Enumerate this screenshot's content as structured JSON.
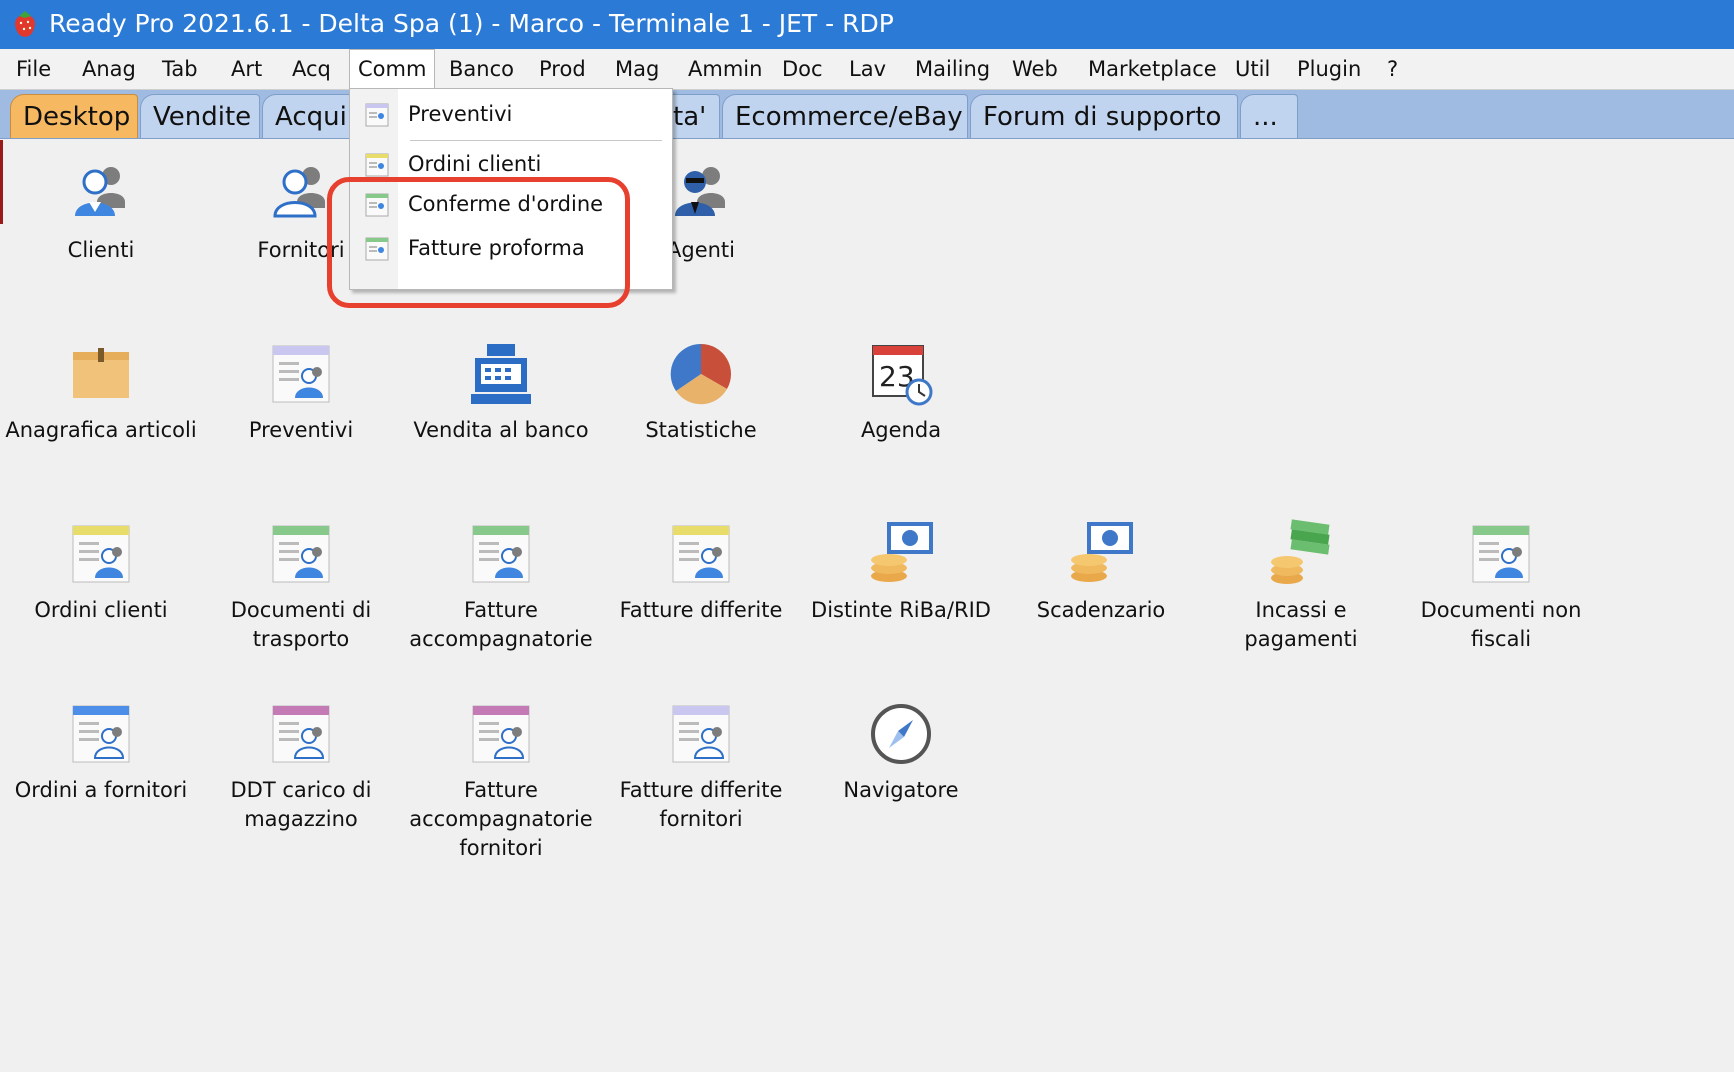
{
  "window": {
    "title": "Ready Pro 2021.6.1 - Delta Spa (1) - Marco - Terminale 1 - JET - RDP",
    "icon": "strawberry-icon"
  },
  "menubar": {
    "items": [
      "File",
      "Anag",
      "Tab",
      "Art",
      "Acq",
      "Comm",
      "Banco",
      "Prod",
      "Mag",
      "Ammin",
      "Doc",
      "Lav",
      "Mailing",
      "Web",
      "Marketplace",
      "Util",
      "Plugin",
      "?"
    ],
    "active": "Comm"
  },
  "tabs": {
    "items": [
      "Desktop",
      "Vendite",
      "Acqui",
      "ta'",
      "Ecommerce/eBay",
      "Forum di supporto",
      "..."
    ],
    "active": "Desktop"
  },
  "dropdown": {
    "items": [
      "Preventivi",
      "Ordini clienti",
      "Conferme d'ordine",
      "Fatture proforma"
    ]
  },
  "desktop": {
    "row1": [
      "Clienti",
      "Fornitori",
      "Agenti"
    ],
    "row2": [
      "Anagrafica articoli",
      "Preventivi",
      "Vendita al banco",
      "Statistiche",
      "Agenda"
    ],
    "row3": [
      "Ordini clienti",
      "Documenti di\ntrasporto",
      "Fatture\naccompagnatorie",
      "Fatture differite",
      "Distinte RiBa/RID",
      "Scadenzario",
      "Incassi e\npagamenti",
      "Documenti non\nfiscali"
    ],
    "row4": [
      "Ordini a fornitori",
      "DDT carico di\nmagazzino",
      "Fatture\naccompagnatorie\nfornitori",
      "Fatture differite\nfornitori",
      "Navigatore"
    ],
    "agenda_day": "23"
  },
  "colors": {
    "titlebar": "#2b7ad6",
    "tab_active": "#f6b861",
    "highlight": "#e8402e",
    "doc_yellow": "#e8dc6a",
    "doc_green": "#86c98a",
    "doc_blue": "#4d8ee8",
    "doc_purple": "#c37ab5",
    "doc_lavender": "#c9c7ef"
  }
}
